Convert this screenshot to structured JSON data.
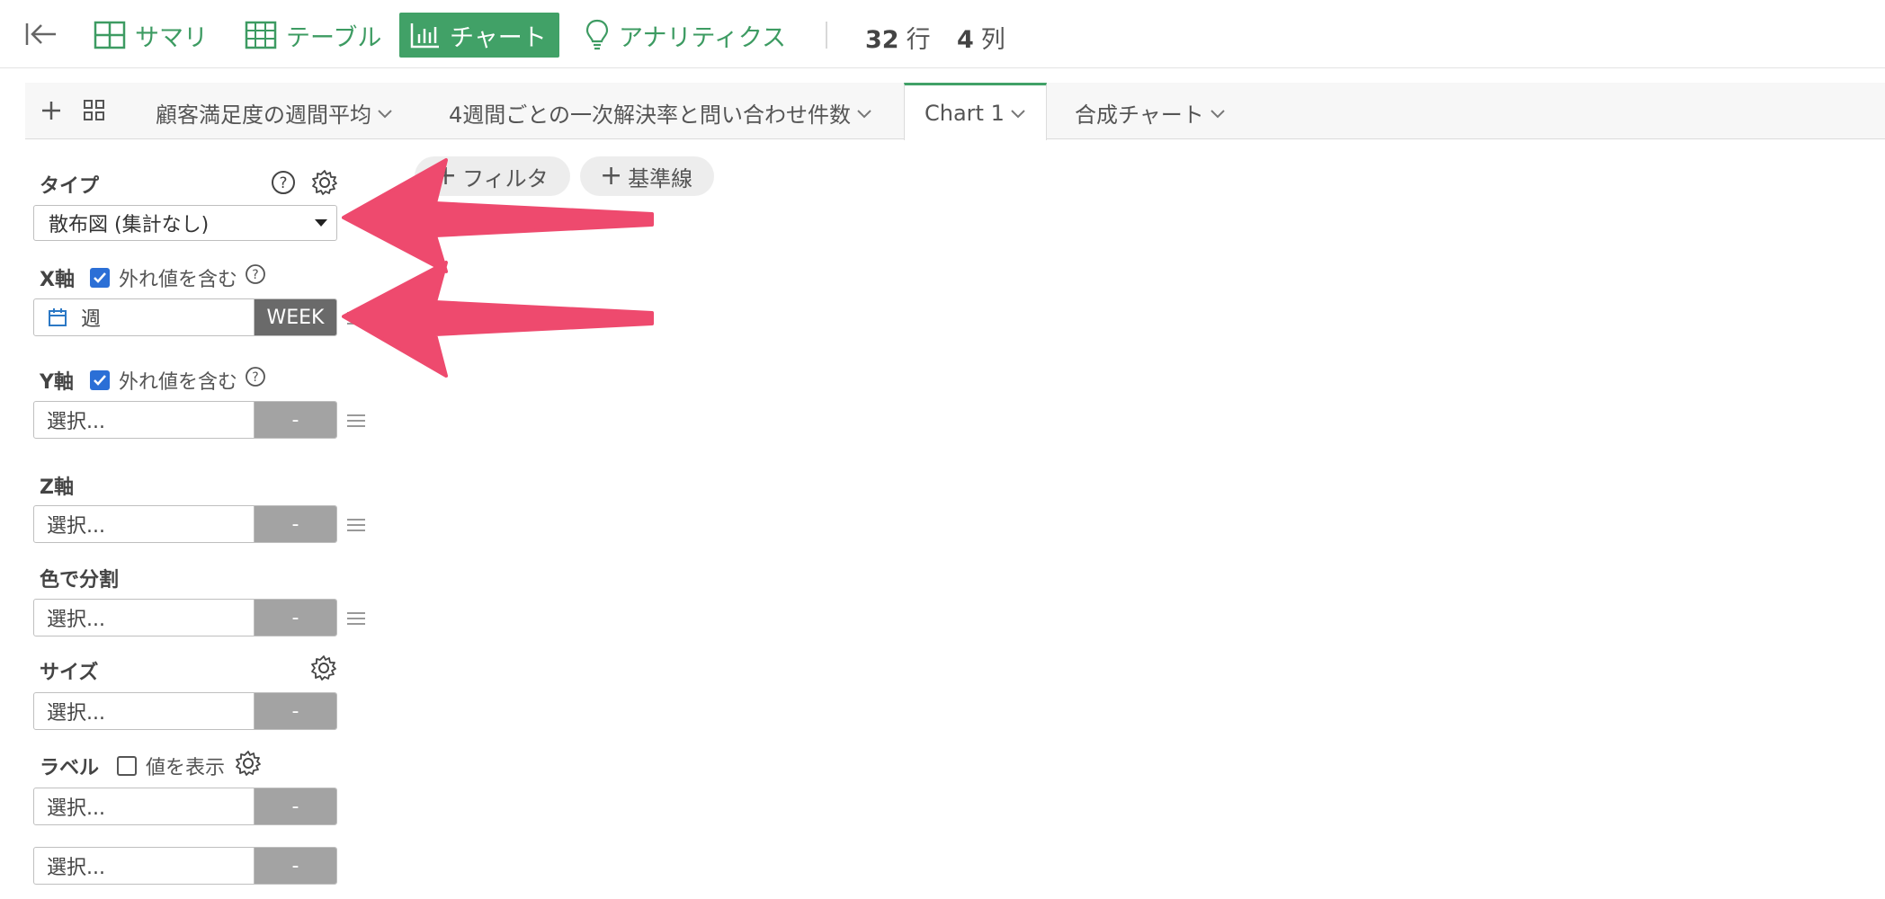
{
  "topbar": {
    "nav": [
      {
        "id": "summary",
        "label": "サマリ",
        "icon": "grid-icon",
        "active": false
      },
      {
        "id": "table",
        "label": "テーブル",
        "icon": "table-icon",
        "active": false
      },
      {
        "id": "chart",
        "label": "チャート",
        "icon": "bar-chart-icon",
        "active": true
      },
      {
        "id": "analytics",
        "label": "アナリティクス",
        "icon": "lightbulb-icon",
        "active": false
      }
    ],
    "rows_count": "32",
    "rows_unit": "行",
    "cols_count": "4",
    "cols_unit": "列"
  },
  "tabs": [
    {
      "label": "顧客満足度の週間平均",
      "active": false
    },
    {
      "label": "4週間ごとの一次解決率と問い合わせ件数",
      "active": false
    },
    {
      "label": "Chart 1",
      "active": true
    },
    {
      "label": "合成チャート",
      "active": false
    }
  ],
  "toolbar": {
    "filter_label": "フィルタ",
    "reference_line_label": "基準線"
  },
  "panel": {
    "type": {
      "label": "タイプ",
      "value": "散布図 (集計なし)"
    },
    "x_axis": {
      "label": "X軸",
      "outlier_label": "外れ値を含む",
      "outlier_checked": true,
      "field_value": "週",
      "field_tag": "WEEK"
    },
    "y_axis": {
      "label": "Y軸",
      "outlier_label": "外れ値を含む",
      "outlier_checked": true,
      "placeholder": "選択...",
      "tag": "-"
    },
    "z_axis": {
      "label": "Z軸",
      "placeholder": "選択...",
      "tag": "-"
    },
    "color": {
      "label": "色で分割",
      "placeholder": "選択...",
      "tag": "-"
    },
    "size": {
      "label": "サイズ",
      "placeholder": "選択...",
      "tag": "-"
    },
    "label": {
      "label": "ラベル",
      "show_values_label": "値を表示",
      "show_values_checked": false,
      "placeholder": "選択...",
      "tag": "-"
    },
    "extra": {
      "placeholder": "選択...",
      "tag": "-"
    }
  },
  "colors": {
    "accent": "#41a167",
    "checkbox": "#2b6fd6",
    "annotation_arrow": "#ee4a6e"
  }
}
